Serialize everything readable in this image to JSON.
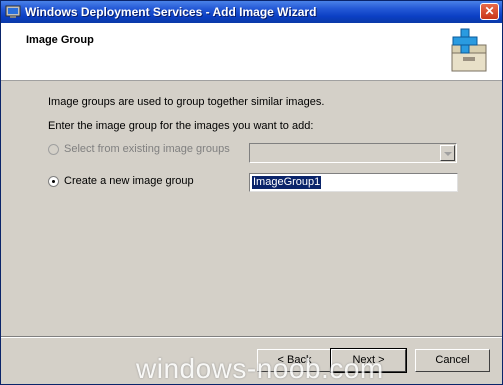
{
  "window": {
    "title": "Windows Deployment Services - Add Image Wizard",
    "close_glyph": "✕"
  },
  "header": {
    "title": "Image Group",
    "icon": "add-package-icon"
  },
  "content": {
    "description": "Image groups are used to group together similar images.",
    "prompt": "Enter the image group for the images you want to add:",
    "existing_option": {
      "label": "Select from existing image groups",
      "selected": false,
      "enabled": false
    },
    "existing_dropdown_value": "",
    "new_option": {
      "label": "Create a new image group",
      "selected": true,
      "enabled": true
    },
    "new_group_name": "ImageGroup1"
  },
  "footer": {
    "back_label": "< Back",
    "next_label": "Next >",
    "cancel_label": "Cancel"
  },
  "watermark": "windows-noob.com",
  "colors": {
    "titlebar": "#0b3fc4",
    "dialog_bg": "#d4d0c8",
    "selection": "#0a246a"
  }
}
